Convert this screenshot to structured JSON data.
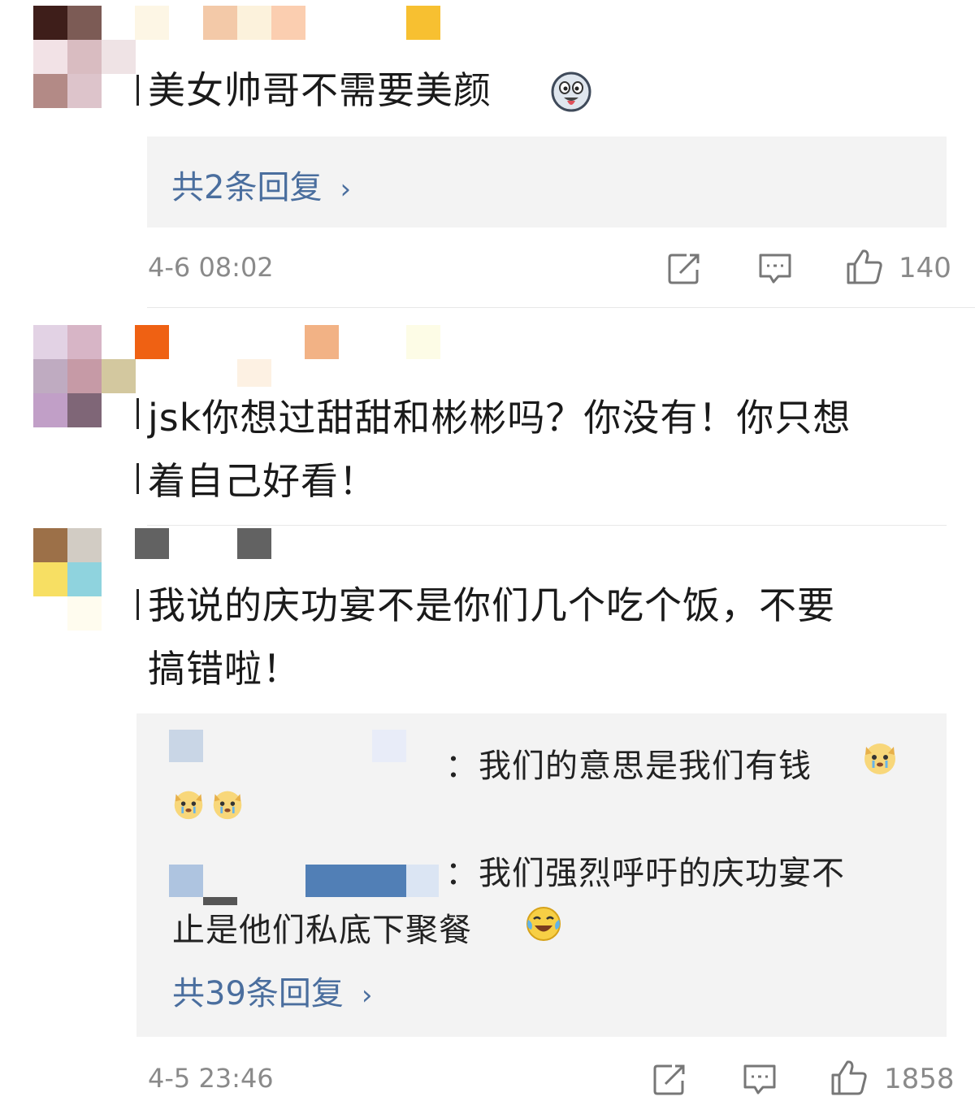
{
  "comments": [
    {
      "text_lines": [
        "美女帅哥不需要美颜"
      ],
      "reply_summary": "共2条回复",
      "time": "4-6 08:02",
      "likes": "140"
    },
    {
      "text_lines": [
        "jsk你想过甜甜和彬彬吗？你没有！你只想",
        "着自己好看！"
      ]
    },
    {
      "text_lines": [
        "我说的庆功宴不是你们几个吃个饭，不要",
        "搞错啦！"
      ],
      "sub_replies": [
        {
          "lines": [
            "：我们的意思是我们有钱"
          ]
        },
        {
          "lines": [
            "：我们强烈呼吁的庆功宴不",
            "止是他们私底下聚餐"
          ]
        }
      ],
      "reply_summary": "共39条回复",
      "time": "4-5 23:46",
      "likes": "1858"
    }
  ],
  "icons": {
    "share": "share-icon",
    "comment": "comment-icon",
    "like": "thumbs-up-icon",
    "chevron": "chevron-right-icon",
    "emoji_husky": "husky-tongue-emoji",
    "emoji_dog_cry": "crying-dog-emoji",
    "emoji_laugh_cry": "laughing-crying-emoji"
  },
  "colors": {
    "link": "#4a6e9e",
    "meta": "#8a8a8a",
    "reply_bg": "#f3f3f3"
  }
}
